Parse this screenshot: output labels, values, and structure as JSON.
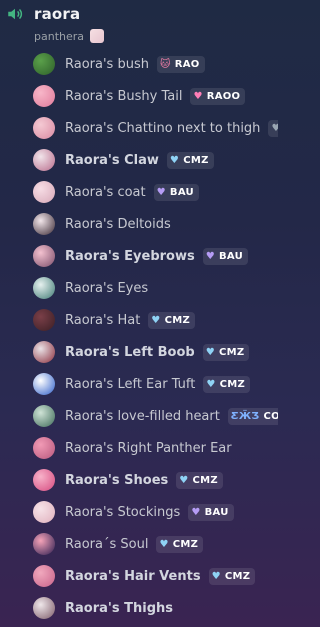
{
  "channel": {
    "name": "raora",
    "owner": "panthera"
  },
  "members": [
    {
      "name": "Raora's bush",
      "tag": "RAO",
      "tag_icon": "cat-face-icon",
      "tag_glyph": "🐱",
      "tag_color": "#f47fa8",
      "avatar_colors": [
        "#5aa04a",
        "#2e5f2a"
      ],
      "bold": false
    },
    {
      "name": "Raora's Bushy Tail",
      "tag": "RAOO",
      "tag_icon": "heart-icon",
      "tag_glyph": "♥",
      "tag_color": "#ff7eb6",
      "avatar_colors": [
        "#f7b6c8",
        "#e07a9b"
      ],
      "bold": false
    },
    {
      "name": "Raora's Chattino next to thigh",
      "tag": "",
      "tag_icon": "heart-icon",
      "tag_glyph": "♥",
      "tag_color": "#9aa6b2",
      "avatar_colors": [
        "#f4c9d3",
        "#d98aa2"
      ],
      "bold": false
    },
    {
      "name": "Raora's Claw",
      "tag": "CMZ",
      "tag_icon": "heart-icon",
      "tag_glyph": "♥",
      "tag_color": "#8fd3f5",
      "avatar_colors": [
        "#f1e4ea",
        "#b86b8b"
      ],
      "bold": true
    },
    {
      "name": "Raora's coat",
      "tag": "BAU",
      "tag_icon": "heart-icon",
      "tag_glyph": "♥",
      "tag_color": "#b59cf5",
      "avatar_colors": [
        "#f6dde5",
        "#d7a8b8"
      ],
      "bold": false
    },
    {
      "name": "Raora's Deltoids",
      "tag": "",
      "tag_icon": "",
      "tag_glyph": "",
      "tag_color": "",
      "avatar_colors": [
        "#f2e6ea",
        "#3b2a35"
      ],
      "bold": false
    },
    {
      "name": "Raora's Eyebrows",
      "tag": "BAU",
      "tag_icon": "heart-icon",
      "tag_glyph": "♥",
      "tag_color": "#b59cf5",
      "avatar_colors": [
        "#f3c1cf",
        "#7b4d6a"
      ],
      "bold": true
    },
    {
      "name": "Raora's Eyes",
      "tag": "",
      "tag_icon": "",
      "tag_glyph": "",
      "tag_color": "",
      "avatar_colors": [
        "#e6f1ef",
        "#3f7a74"
      ],
      "bold": false
    },
    {
      "name": "Raora's Hat",
      "tag": "CMZ",
      "tag_icon": "heart-icon",
      "tag_glyph": "♥",
      "tag_color": "#8fd3f5",
      "avatar_colors": [
        "#7a3f48",
        "#3a1e24"
      ],
      "bold": false
    },
    {
      "name": "Raora's Left Boob",
      "tag": "CMZ",
      "tag_icon": "heart-icon",
      "tag_glyph": "♥",
      "tag_color": "#8fd3f5",
      "avatar_colors": [
        "#e9e2e6",
        "#8a2e3d"
      ],
      "bold": true
    },
    {
      "name": "Raora's Left Ear Tuft",
      "tag": "CMZ",
      "tag_icon": "heart-icon",
      "tag_glyph": "♥",
      "tag_color": "#8fd3f5",
      "avatar_colors": [
        "#ffffff",
        "#2d5ec9"
      ],
      "bold": false
    },
    {
      "name": "Raora's love-filled heart",
      "tag": "COZY",
      "tag_icon": "butterfly-icon",
      "tag_glyph": "ƸӜƷ",
      "tag_color": "#7fb2ff",
      "avatar_colors": [
        "#cfe3d6",
        "#3d6a58"
      ],
      "bold": false
    },
    {
      "name": "Raora's Right Panther Ear",
      "tag": "",
      "tag_icon": "",
      "tag_glyph": "",
      "tag_color": "",
      "avatar_colors": [
        "#f19ab5",
        "#b8587d"
      ],
      "bold": false
    },
    {
      "name": "Raora's Shoes",
      "tag": "CMZ",
      "tag_icon": "heart-icon",
      "tag_glyph": "♥",
      "tag_color": "#8fd3f5",
      "avatar_colors": [
        "#f7b2c9",
        "#d6497f"
      ],
      "bold": true
    },
    {
      "name": "Raora's Stockings",
      "tag": "BAU",
      "tag_icon": "heart-icon",
      "tag_glyph": "♥",
      "tag_color": "#b59cf5",
      "avatar_colors": [
        "#f6e3e8",
        "#e0b0bd"
      ],
      "bold": false
    },
    {
      "name": "Raora´s Soul",
      "tag": "CMZ",
      "tag_icon": "heart-icon",
      "tag_glyph": "♥",
      "tag_color": "#8fd3f5",
      "avatar_colors": [
        "#f5a3b8",
        "#2b1c4f"
      ],
      "bold": false
    },
    {
      "name": "Raora's Hair Vents",
      "tag": "CMZ",
      "tag_icon": "heart-icon",
      "tag_glyph": "♥",
      "tag_color": "#8fd3f5",
      "avatar_colors": [
        "#f0a8bd",
        "#c8628a"
      ],
      "bold": true
    },
    {
      "name": "Raora's Thighs",
      "tag": "",
      "tag_icon": "",
      "tag_glyph": "",
      "tag_color": "",
      "avatar_colors": [
        "#efe7ea",
        "#7c5a68"
      ],
      "bold": true
    }
  ]
}
